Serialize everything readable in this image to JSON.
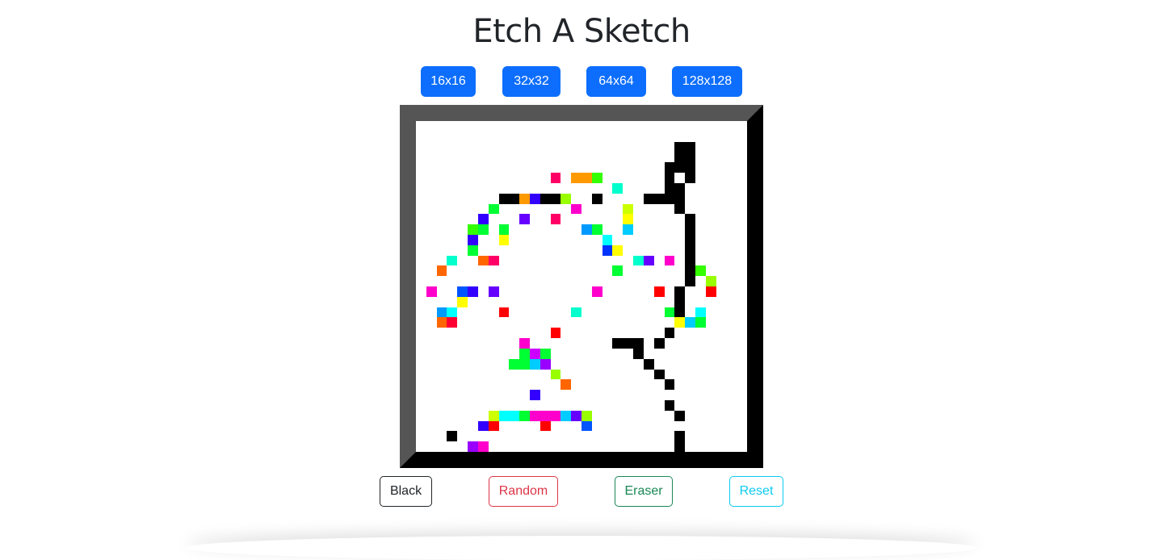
{
  "title": "Etch A Sketch",
  "grid_sizes": [
    "16x16",
    "32x32",
    "64x64",
    "128x128"
  ],
  "modes": [
    {
      "label": "Black",
      "color": "#212529"
    },
    {
      "label": "Random",
      "color": "#dc3545"
    },
    {
      "label": "Eraser",
      "color": "#198754"
    },
    {
      "label": "Reset",
      "color": "#0dcaf0"
    }
  ],
  "board": {
    "grid": 32,
    "cells": [
      [
        25,
        2,
        "#000000"
      ],
      [
        26,
        2,
        "#000000"
      ],
      [
        25,
        3,
        "#000000"
      ],
      [
        26,
        3,
        "#000000"
      ],
      [
        24,
        4,
        "#000000"
      ],
      [
        25,
        4,
        "#000000"
      ],
      [
        26,
        4,
        "#000000"
      ],
      [
        24,
        5,
        "#000000"
      ],
      [
        26,
        5,
        "#000000"
      ],
      [
        13,
        5,
        "#ff0066"
      ],
      [
        15,
        5,
        "#ff9900"
      ],
      [
        16,
        5,
        "#ff9900"
      ],
      [
        17,
        5,
        "#33ff00"
      ],
      [
        24,
        6,
        "#000000"
      ],
      [
        25,
        6,
        "#000000"
      ],
      [
        19,
        6,
        "#00ffcc"
      ],
      [
        8,
        7,
        "#000000"
      ],
      [
        9,
        7,
        "#000000"
      ],
      [
        10,
        7,
        "#ff9900"
      ],
      [
        11,
        7,
        "#3300ff"
      ],
      [
        12,
        7,
        "#000000"
      ],
      [
        13,
        7,
        "#000000"
      ],
      [
        14,
        7,
        "#99ff00"
      ],
      [
        17,
        7,
        "#000000"
      ],
      [
        22,
        7,
        "#000000"
      ],
      [
        23,
        7,
        "#000000"
      ],
      [
        24,
        7,
        "#000000"
      ],
      [
        25,
        7,
        "#000000"
      ],
      [
        7,
        8,
        "#00ff33"
      ],
      [
        15,
        8,
        "#ff00cc"
      ],
      [
        20,
        8,
        "#ccff00"
      ],
      [
        25,
        8,
        "#000000"
      ],
      [
        6,
        9,
        "#3300ff"
      ],
      [
        10,
        9,
        "#6600ff"
      ],
      [
        13,
        9,
        "#ff0066"
      ],
      [
        20,
        9,
        "#ffff00"
      ],
      [
        26,
        9,
        "#000000"
      ],
      [
        5,
        10,
        "#33ff00"
      ],
      [
        6,
        10,
        "#00ff33"
      ],
      [
        8,
        10,
        "#00ff33"
      ],
      [
        16,
        10,
        "#0099ff"
      ],
      [
        17,
        10,
        "#00ff33"
      ],
      [
        20,
        10,
        "#00ccff"
      ],
      [
        26,
        10,
        "#000000"
      ],
      [
        5,
        11,
        "#3300ff"
      ],
      [
        8,
        11,
        "#ffff00"
      ],
      [
        18,
        11,
        "#00ffff"
      ],
      [
        26,
        11,
        "#000000"
      ],
      [
        5,
        12,
        "#00ff33"
      ],
      [
        18,
        12,
        "#0033ff"
      ],
      [
        19,
        12,
        "#ffff00"
      ],
      [
        26,
        12,
        "#000000"
      ],
      [
        3,
        13,
        "#00ffcc"
      ],
      [
        6,
        13,
        "#ff6600"
      ],
      [
        7,
        13,
        "#ff0066"
      ],
      [
        21,
        13,
        "#00ffcc"
      ],
      [
        22,
        13,
        "#6600ff"
      ],
      [
        24,
        13,
        "#ff00cc"
      ],
      [
        26,
        13,
        "#000000"
      ],
      [
        2,
        14,
        "#ff6600"
      ],
      [
        19,
        14,
        "#00ff33"
      ],
      [
        26,
        14,
        "#000000"
      ],
      [
        27,
        14,
        "#33ff00"
      ],
      [
        26,
        15,
        "#000000"
      ],
      [
        28,
        15,
        "#99ff00"
      ],
      [
        1,
        16,
        "#ff00cc"
      ],
      [
        4,
        16,
        "#0055ff"
      ],
      [
        5,
        16,
        "#3300ff"
      ],
      [
        7,
        16,
        "#6600ff"
      ],
      [
        17,
        16,
        "#ff00cc"
      ],
      [
        23,
        16,
        "#ff0000"
      ],
      [
        25,
        16,
        "#000000"
      ],
      [
        28,
        16,
        "#ff0000"
      ],
      [
        4,
        17,
        "#ffff00"
      ],
      [
        25,
        17,
        "#000000"
      ],
      [
        2,
        18,
        "#0099ff"
      ],
      [
        3,
        18,
        "#00ffff"
      ],
      [
        8,
        18,
        "#ff0000"
      ],
      [
        15,
        18,
        "#00ffcc"
      ],
      [
        24,
        18,
        "#00ff33"
      ],
      [
        25,
        18,
        "#000000"
      ],
      [
        27,
        18,
        "#00ffff"
      ],
      [
        2,
        19,
        "#ff6600"
      ],
      [
        3,
        19,
        "#ff0033"
      ],
      [
        25,
        19,
        "#ffff00"
      ],
      [
        26,
        19,
        "#00ccff"
      ],
      [
        27,
        19,
        "#00ff33"
      ],
      [
        13,
        20,
        "#ff0000"
      ],
      [
        24,
        20,
        "#000000"
      ],
      [
        10,
        21,
        "#ff00cc"
      ],
      [
        19,
        21,
        "#000000"
      ],
      [
        20,
        21,
        "#000000"
      ],
      [
        21,
        21,
        "#000000"
      ],
      [
        23,
        21,
        "#000000"
      ],
      [
        10,
        22,
        "#00ff33"
      ],
      [
        11,
        22,
        "#cc00ff"
      ],
      [
        12,
        22,
        "#00ff33"
      ],
      [
        21,
        22,
        "#000000"
      ],
      [
        9,
        23,
        "#00ff33"
      ],
      [
        10,
        23,
        "#00ff33"
      ],
      [
        11,
        23,
        "#00ccff"
      ],
      [
        12,
        23,
        "#9900ff"
      ],
      [
        22,
        23,
        "#000000"
      ],
      [
        13,
        24,
        "#99ff00"
      ],
      [
        23,
        24,
        "#000000"
      ],
      [
        14,
        25,
        "#ff6600"
      ],
      [
        24,
        25,
        "#000000"
      ],
      [
        11,
        26,
        "#3300ff"
      ],
      [
        24,
        27,
        "#000000"
      ],
      [
        7,
        28,
        "#ccff00"
      ],
      [
        8,
        28,
        "#00ffff"
      ],
      [
        9,
        28,
        "#00ffff"
      ],
      [
        10,
        28,
        "#00ff33"
      ],
      [
        11,
        28,
        "#ff00cc"
      ],
      [
        12,
        28,
        "#ff00cc"
      ],
      [
        13,
        28,
        "#ff00cc"
      ],
      [
        14,
        28,
        "#00ccff"
      ],
      [
        15,
        28,
        "#6600ff"
      ],
      [
        16,
        28,
        "#99ff00"
      ],
      [
        25,
        28,
        "#000000"
      ],
      [
        6,
        29,
        "#3300ff"
      ],
      [
        7,
        29,
        "#ff0000"
      ],
      [
        12,
        29,
        "#ff0000"
      ],
      [
        16,
        29,
        "#0055ff"
      ],
      [
        3,
        30,
        "#000000"
      ],
      [
        25,
        30,
        "#000000"
      ],
      [
        5,
        31,
        "#9900ff"
      ],
      [
        6,
        31,
        "#ff00cc"
      ],
      [
        25,
        31,
        "#000000"
      ]
    ]
  }
}
